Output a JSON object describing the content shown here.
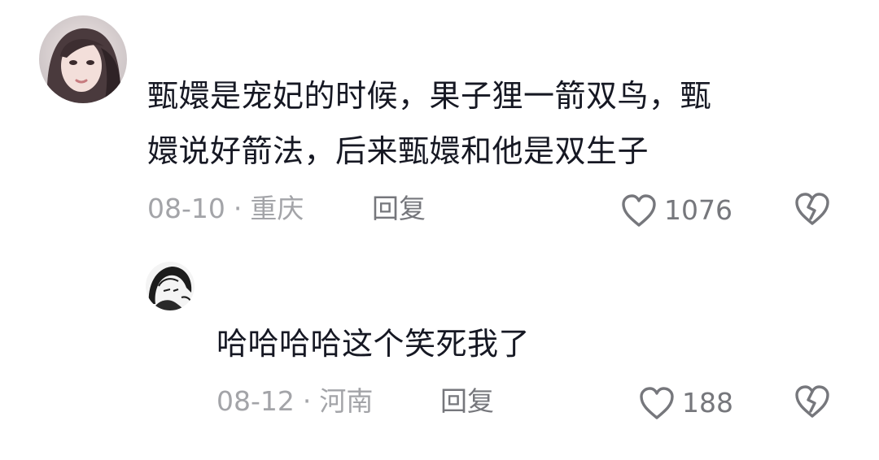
{
  "comments": [
    {
      "text_line1": "甄嬛是宠妃的时候，果子狸一箭双鸟，甄",
      "text_line2": "嬛说好箭法，后来甄嬛和他是双生子",
      "date": "08-10",
      "location": "重庆",
      "reply_label": "回复",
      "like_count": "1076",
      "icons": {
        "like": "heart-outline-icon",
        "dislike": "broken-heart-icon"
      }
    },
    {
      "text": "哈哈哈哈这个笑死我了",
      "date": "08-12",
      "location": "河南",
      "reply_label": "回复",
      "like_count": "188",
      "icons": {
        "like": "heart-outline-icon",
        "dislike": "broken-heart-icon"
      }
    }
  ],
  "separator": "·",
  "colors": {
    "text": "#161823",
    "meta": "#a3a4a8",
    "action": "#76777c",
    "background": "#ffffff"
  }
}
